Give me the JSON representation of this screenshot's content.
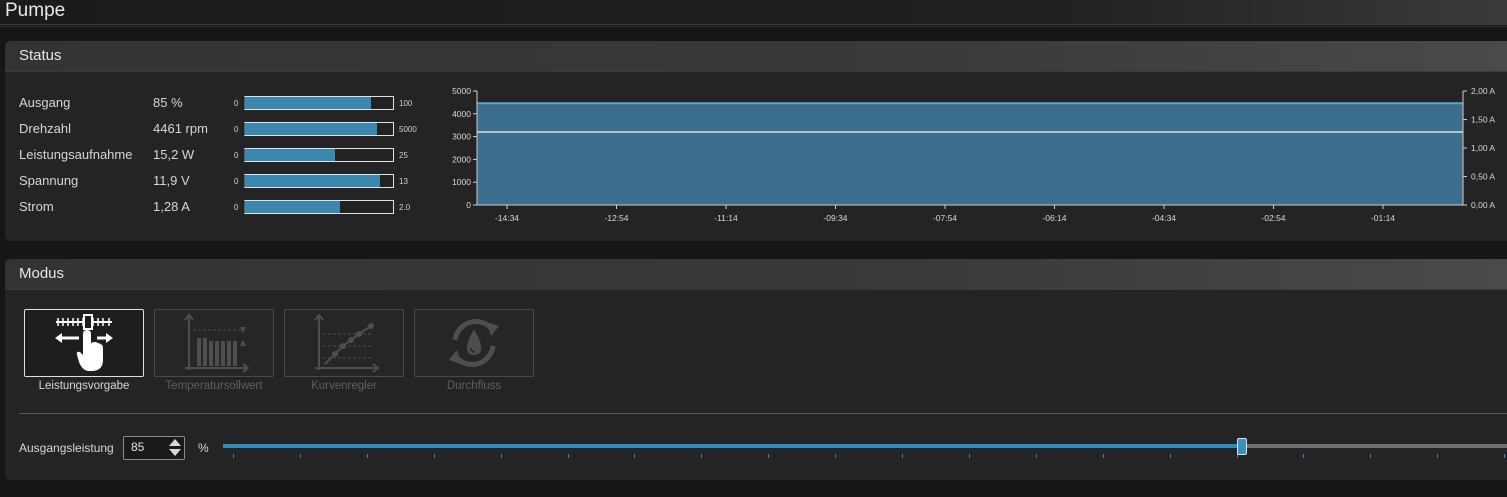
{
  "page_title": "Pumpe",
  "status": {
    "title": "Status",
    "rows": [
      {
        "label": "Ausgang",
        "value": "85 %",
        "min": "0",
        "max": "100",
        "fill": 0.85
      },
      {
        "label": "Drehzahl",
        "value": "4461 rpm",
        "min": "0",
        "max": "5000",
        "fill": 0.892
      },
      {
        "label": "Leistungsaufnahme",
        "value": "15,2 W",
        "min": "0",
        "max": "25",
        "fill": 0.608
      },
      {
        "label": "Spannung",
        "value": "11,9 V",
        "min": "0",
        "max": "13",
        "fill": 0.915
      },
      {
        "label": "Strom",
        "value": "1,28 A",
        "min": "0",
        "max": "2.0",
        "fill": 0.64
      }
    ]
  },
  "chart_data": {
    "type": "area",
    "x_tick_labels": [
      "-14:34",
      "-12:54",
      "-11:14",
      "-09:34",
      "-07:54",
      "-06:14",
      "-04:34",
      "-02:54",
      "-01:14"
    ],
    "y_left_ticks": [
      "5000",
      "4000",
      "3000",
      "2000",
      "1000",
      "0"
    ],
    "y_right_ticks": [
      "2,00 A",
      "1,50 A",
      "1,00 A",
      "0,50 A",
      "0,00 A"
    ],
    "y_left_range": [
      0,
      5000
    ],
    "y_right_range": [
      0,
      2.0
    ],
    "series": [
      {
        "values_left_axis": 4461,
        "color": "#3b6d8c",
        "line_color": "#5fa6cc"
      },
      {
        "values_right_axis": 1.28,
        "color": "#e0e0e0"
      }
    ],
    "grid": false
  },
  "modus": {
    "title": "Modus",
    "buttons": [
      {
        "label": "Leistungsvorgabe",
        "icon": "slider-hand-icon",
        "active": true
      },
      {
        "label": "Temperatursollwert",
        "icon": "temperature-chart-icon",
        "active": false
      },
      {
        "label": "Kurvenregler",
        "icon": "curve-chart-icon",
        "active": false
      },
      {
        "label": "Durchfluss",
        "icon": "flow-drop-icon",
        "active": false
      }
    ],
    "output_label": "Ausgangsleistung",
    "output_value": "85",
    "unit": "%",
    "slider_fraction": 0.885
  },
  "colors": {
    "accent": "#3a87b0",
    "panel": "#242424",
    "background": "#161616"
  }
}
